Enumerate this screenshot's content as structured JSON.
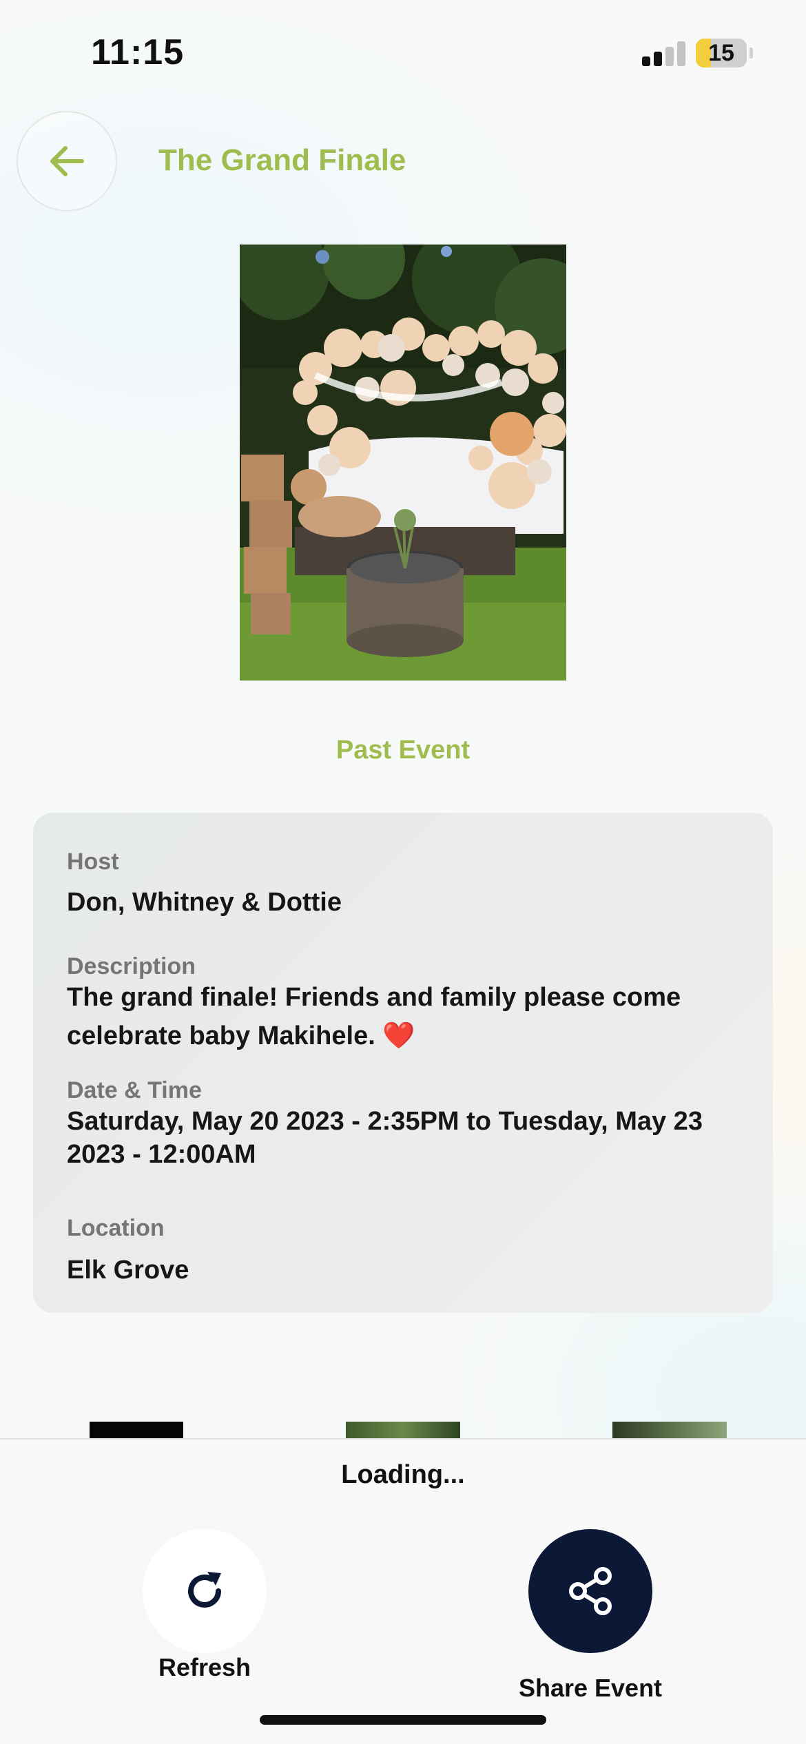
{
  "status_bar": {
    "time": "11:15",
    "battery_percent": "15",
    "battery_level": 0.15,
    "signal_bars_active": 2,
    "signal_bars_total": 4
  },
  "header": {
    "title": "The Grand Finale",
    "back_icon": "arrow-left-icon"
  },
  "event": {
    "image_alt": "photo-baby-shower-balloon-arch",
    "status_label": "Past Event",
    "host_label": "Host",
    "host": "Don, Whitney & Dottie",
    "description_label": "Description",
    "description": "The grand finale! Friends and family please come celebrate baby Makihele. ❤️",
    "datetime_label": "Date & Time",
    "datetime": "Saturday, May 20 2023 - 2:35PM to Tuesday, May 23 2023 - 12:00AM",
    "location_label": "Location",
    "location": "Elk Grove"
  },
  "footer": {
    "loading_text": "Loading...",
    "refresh_label": "Refresh",
    "refresh_icon": "refresh-icon",
    "share_label": "Share Event",
    "share_icon": "share-icon"
  },
  "colors": {
    "accent_green": "#9ebd4e",
    "share_button_navy": "#0b1836",
    "battery_yellow": "#f2cd3c"
  }
}
